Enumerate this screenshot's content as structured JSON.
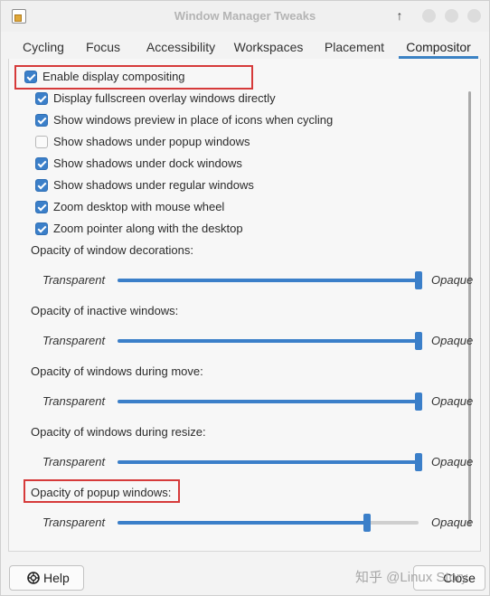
{
  "window": {
    "title": "Window Manager Tweaks"
  },
  "titlebar_icons": {
    "app": "app-icon",
    "keep_above": "up-arrow-icon",
    "keep_above_glyph": "↑"
  },
  "tabs": [
    {
      "label": "Cycling",
      "active": false
    },
    {
      "label": "Focus",
      "active": false
    },
    {
      "label": "Accessibility",
      "active": false
    },
    {
      "label": "Workspaces",
      "active": false
    },
    {
      "label": "Placement",
      "active": false
    },
    {
      "label": "Compositor",
      "active": true
    }
  ],
  "compositor": {
    "enable": {
      "label": "Enable display compositing",
      "checked": true
    },
    "options": [
      {
        "label": "Display fullscreen overlay windows directly",
        "checked": true
      },
      {
        "label": "Show windows preview in place of icons when cycling",
        "checked": true
      },
      {
        "label": "Show shadows under popup windows",
        "checked": false
      },
      {
        "label": "Show shadows under dock windows",
        "checked": true
      },
      {
        "label": "Show shadows under regular windows",
        "checked": true
      },
      {
        "label": "Zoom desktop with mouse wheel",
        "checked": true
      },
      {
        "label": "Zoom pointer along with the desktop",
        "checked": true
      }
    ],
    "sliders": [
      {
        "label": "Opacity of window decorations:",
        "left": "Transparent",
        "right": "Opaque",
        "value": 1.0
      },
      {
        "label": "Opacity of inactive windows:",
        "left": "Transparent",
        "right": "Opaque",
        "value": 1.0
      },
      {
        "label": "Opacity of windows during move:",
        "left": "Transparent",
        "right": "Opaque",
        "value": 1.0
      },
      {
        "label": "Opacity of windows during resize:",
        "left": "Transparent",
        "right": "Opaque",
        "value": 1.0
      },
      {
        "label": "Opacity of popup windows:",
        "left": "Transparent",
        "right": "Opaque",
        "value": 0.83
      }
    ]
  },
  "footer": {
    "help_label": "Help",
    "close_label": "Close",
    "watermark": "知乎 @Linux Story"
  },
  "colors": {
    "accent": "#3b7fc9",
    "highlight": "#d63a3a"
  }
}
